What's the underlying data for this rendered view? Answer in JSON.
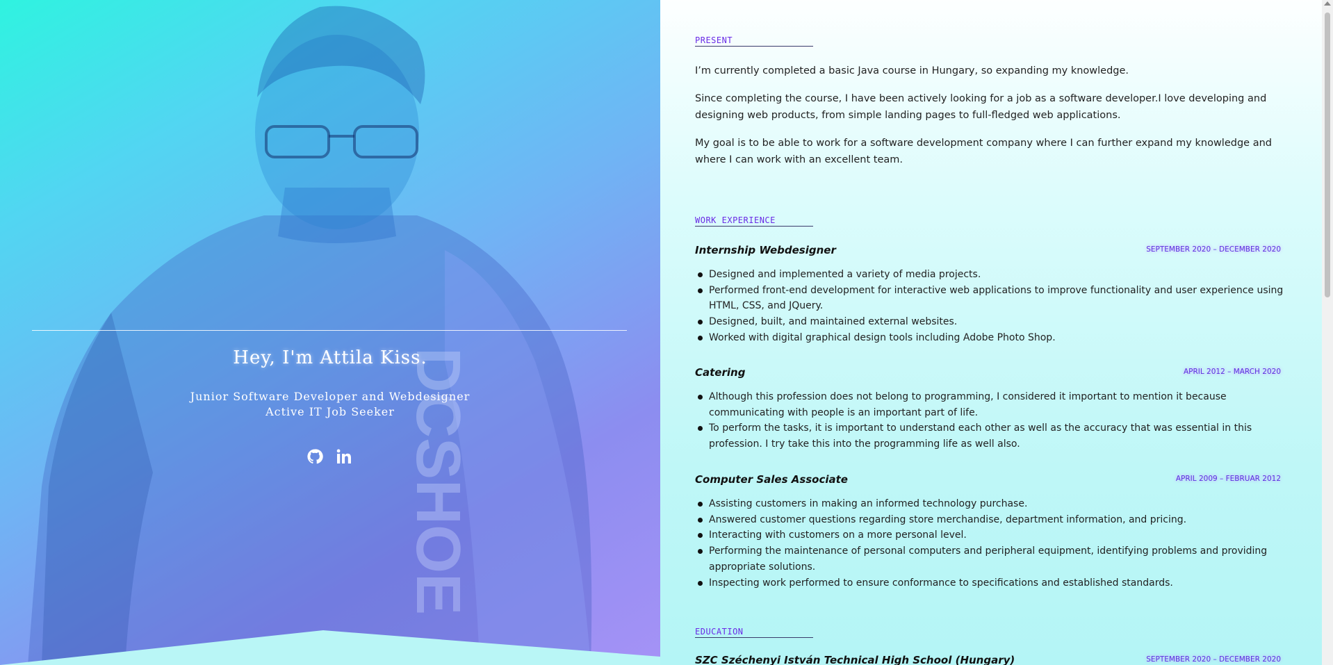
{
  "hero": {
    "title": "Hey, I'm Attila Kiss.",
    "subtitle_line1": "Junior Software Developer and Webdesigner",
    "subtitle_line2": "Active IT Job Seeker",
    "shirt_text": "DCSHOE",
    "social": [
      {
        "name": "GitHub",
        "icon": "github-icon"
      },
      {
        "name": "LinkedIn",
        "icon": "linkedin-icon"
      }
    ]
  },
  "present": {
    "heading": "PRESENT",
    "paragraphs": [
      "I’m currently completed a basic Java course in Hungary, so expanding my knowledge.",
      "Since completing the course, I have been actively looking for a job as a software developer.I love developing and designing web products, from simple landing pages to full-fledged web applications.",
      "My goal is to be able to work for a software development company where I can further expand my knowledge and where I can work with an excellent team."
    ]
  },
  "work": {
    "heading": "WORK EXPERIENCE",
    "jobs": [
      {
        "title": "Internship Webdesigner",
        "date": "SEPTEMBER 2020 – DECEMBER 2020",
        "items": [
          "Designed and implemented a variety of media projects.",
          "Performed front-end development for interactive web applications to improve functionality and user experience using HTML, CSS, and JQuery.",
          "Designed, built, and maintained external websites.",
          "Worked with digital graphical design tools including Adobe Photo Shop."
        ]
      },
      {
        "title": "Catering",
        "date": "APRIL 2012 – MARCH 2020",
        "items": [
          "Although this profession does not belong to programming, I considered it important to mention it because communicating with people is an important part of life.",
          "To perform the tasks, it is important to understand each other as well as the accuracy that was essential in this profession. I try take this into the programming life as well also."
        ]
      },
      {
        "title": "Computer Sales Associate",
        "date": "APRIL 2009 – FEBRUAR 2012",
        "items": [
          "Assisting customers in making an informed technology purchase.",
          "Answered customer questions regarding store merchandise, department information, and pricing.",
          "Interacting with customers on a more personal level.",
          "Performing the maintenance of personal computers and peripheral equipment, identifying problems and providing appropriate solutions.",
          "Inspecting work performed to ensure conformance to specifications and established standards."
        ]
      }
    ]
  },
  "education": {
    "heading": "EDUCATION",
    "entries": [
      {
        "title": "SZC Széchenyi István Technical High School (Hungary)",
        "date": "SEPTEMBER 2020 – DECEMBER 2020"
      }
    ]
  },
  "colors": {
    "accent": "#6a2be6",
    "date": "#5d2ee0",
    "hero_start": "#2ff3e0",
    "hero_end": "#a592f6"
  }
}
